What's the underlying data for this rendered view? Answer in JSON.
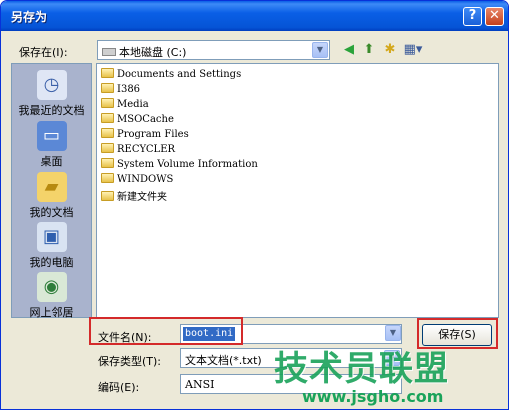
{
  "window": {
    "title": "另存为",
    "help_glyph": "?",
    "close_glyph": "✕"
  },
  "save_in": {
    "label": "保存在(I):",
    "value": "本地磁盘 (C:)"
  },
  "toolbar": {
    "icons": [
      "back-icon",
      "up-folder-icon",
      "new-folder-icon",
      "views-icon"
    ]
  },
  "places": [
    {
      "label": "我最近的文档",
      "icon": "recent-documents-icon"
    },
    {
      "label": "桌面",
      "icon": "desktop-icon"
    },
    {
      "label": "我的文档",
      "icon": "my-documents-icon"
    },
    {
      "label": "我的电脑",
      "icon": "my-computer-icon"
    },
    {
      "label": "网上邻居",
      "icon": "network-places-icon"
    }
  ],
  "files": [
    "Documents and Settings",
    "I386",
    "Media",
    "MSOCache",
    "Program Files",
    "RECYCLER",
    "System Volume Information",
    "WINDOWS",
    "新建文件夹"
  ],
  "filename": {
    "label": "文件名(N):",
    "value": "boot.ini"
  },
  "filetype": {
    "label": "保存类型(T):",
    "value": "文本文档(*.txt)"
  },
  "encoding": {
    "label": "编码(E):",
    "value": "ANSI"
  },
  "buttons": {
    "save": "保存(S)"
  },
  "watermark": {
    "main": "技术员联盟",
    "url": "www.jsgho.com"
  },
  "colors": {
    "titlebar": "#0a5fe6",
    "highlight": "#d42a2a",
    "watermark": "#1aa35a"
  }
}
